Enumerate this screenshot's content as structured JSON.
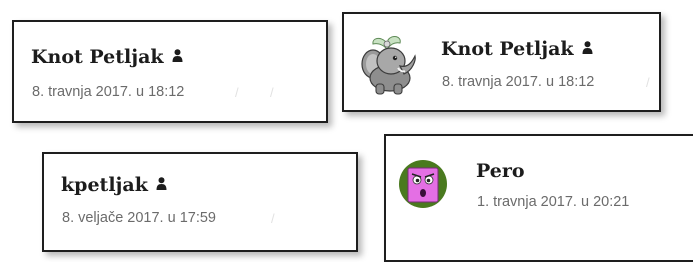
{
  "cards": [
    {
      "name": "Knot Petljak",
      "date": "8. travnja 2017. u 18:12",
      "avatar": "none",
      "icon": "person-icon"
    },
    {
      "name": "Knot Petljak",
      "date": "8. travnja 2017. u 18:12",
      "avatar": "elephant-avatar",
      "icon": "person-icon"
    },
    {
      "name": "kpetljak",
      "date": "8. veljače 2017. u 17:59",
      "avatar": "none",
      "icon": "person-icon"
    },
    {
      "name": "Pero",
      "date": "1. travnja 2017. u 20:21",
      "avatar": "pink-monster-avatar",
      "icon": "none"
    }
  ],
  "colors": {
    "border": "#1e1e1e",
    "name_text": "#1c1c1c",
    "date_text": "#6b6b6b",
    "avatar_bg": "#4a7a1f",
    "avatar_face": "#e46fe4"
  }
}
